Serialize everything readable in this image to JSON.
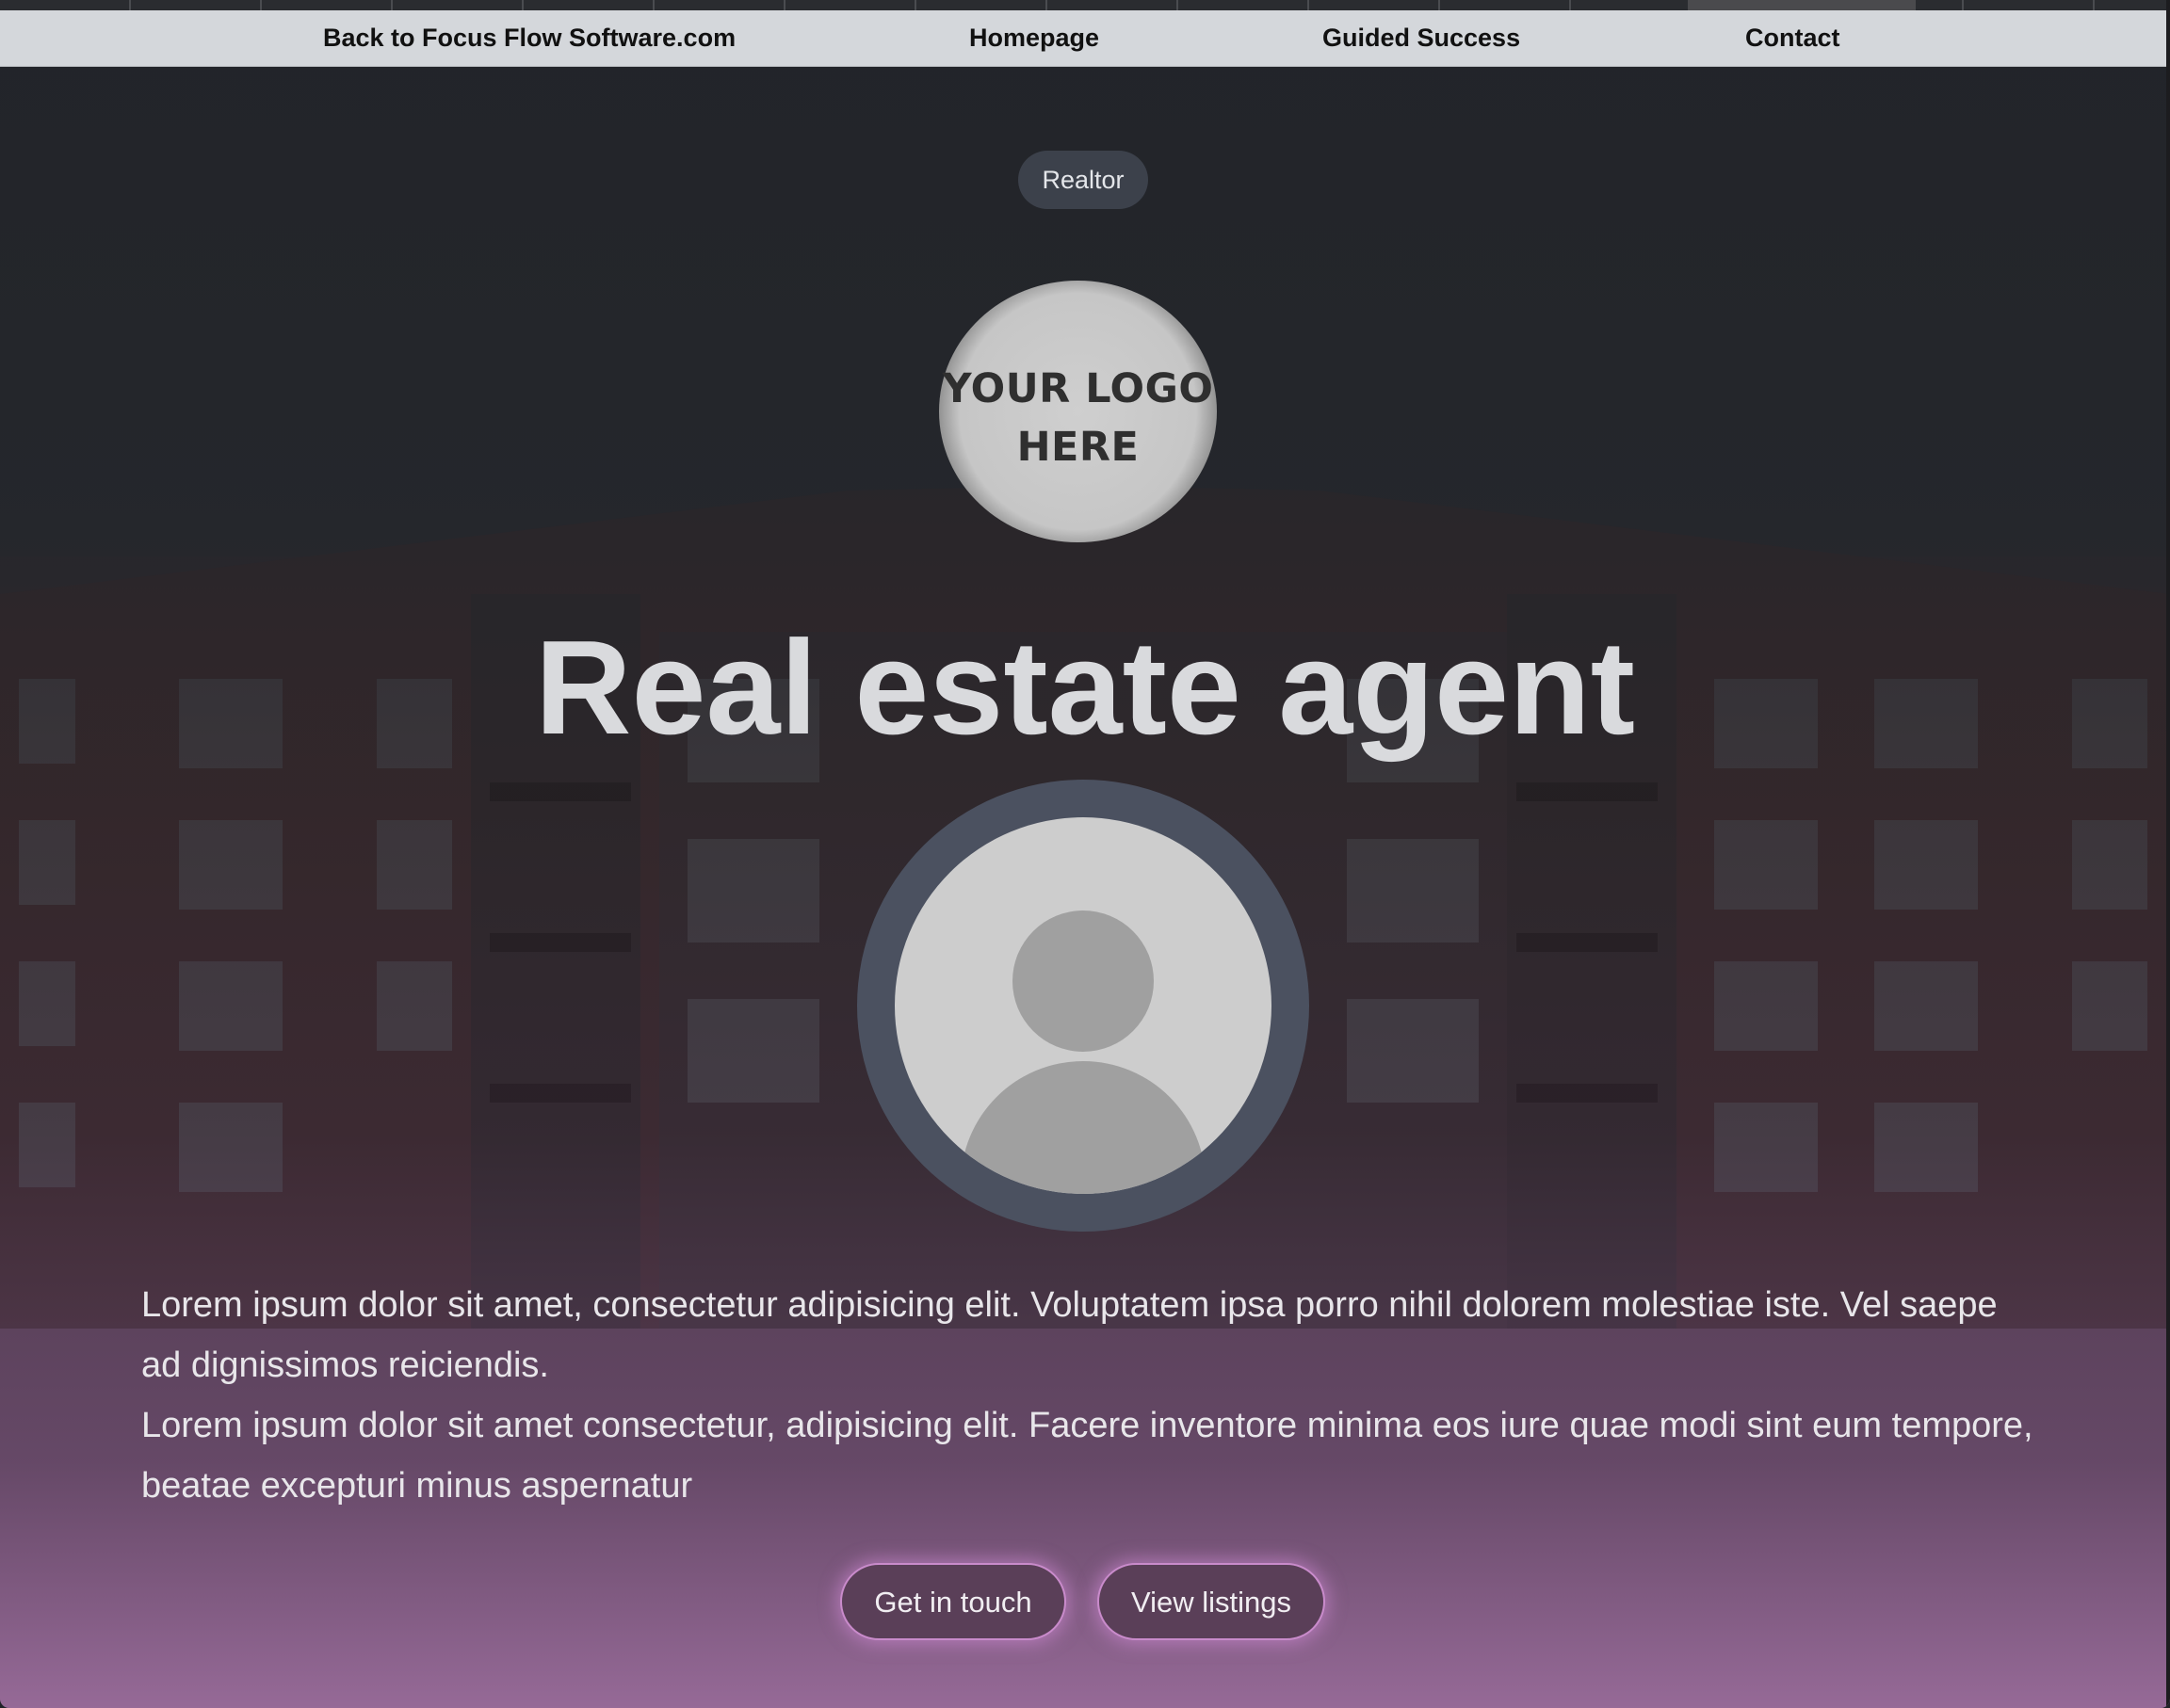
{
  "nav": {
    "items": [
      {
        "label": "Back to Focus Flow Software.com"
      },
      {
        "label": "Homepage"
      },
      {
        "label": "Guided Success"
      },
      {
        "label": "Contact"
      }
    ]
  },
  "hero": {
    "badge": "Realtor",
    "logo_lines": [
      "YOUR LOGO",
      "HERE"
    ],
    "title": "Real estate agent",
    "paragraphs": [
      "Lorem ipsum dolor sit amet, consectetur adipisicing elit. Voluptatem ipsa porro nihil dolorem molestiae iste. Vel saepe ad dignissimos reiciendis.",
      "Lorem ipsum dolor sit amet consectetur, adipisicing elit. Facere inventore minima eos iure quae modi sint eum tempore, beatae excepturi minus aspernatur"
    ],
    "buttons": {
      "primary": "Get in touch",
      "secondary": "View listings"
    }
  },
  "colors": {
    "nav_bg": "#d4d7db",
    "badge_bg": "#3c414b",
    "avatar_ring": "#4b5160",
    "button_border": "#c98bcb",
    "gradient_bottom": "#a070a2"
  },
  "icons": {
    "avatar": "person-placeholder-icon"
  }
}
